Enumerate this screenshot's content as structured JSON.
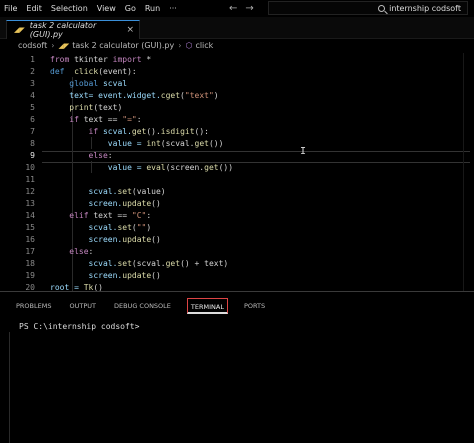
{
  "menu": [
    "File",
    "Edit",
    "Selection",
    "View",
    "Go",
    "Run",
    "···"
  ],
  "nav": {
    "back": "←",
    "forward": "→"
  },
  "search": {
    "text": "internship codsoft"
  },
  "tab": {
    "label": "task 2 calculator (GUI).py",
    "icon": "py-file-icon",
    "close": "×"
  },
  "breadcrumb": {
    "folder": "codsoft",
    "file": "task 2 calculator (GUI).py",
    "symbol": "click"
  },
  "editor": {
    "active_line": 9,
    "lines": [
      {
        "n": "1",
        "tokens": [
          {
            "t": "from",
            "c": "kw"
          },
          {
            "t": " tkinter ",
            "c": "plain"
          },
          {
            "t": "import",
            "c": "kw"
          },
          {
            "t": " *",
            "c": "plain"
          }
        ]
      },
      {
        "n": "2",
        "tokens": [
          {
            "t": "def",
            "c": "kw2"
          },
          {
            "t": "  ",
            "c": "plain"
          },
          {
            "t": "click",
            "c": "fn"
          },
          {
            "t": "(event):",
            "c": "plain"
          }
        ]
      },
      {
        "n": "3",
        "tokens": [
          {
            "t": "    ",
            "c": "plain"
          },
          {
            "t": "global",
            "c": "kw2"
          },
          {
            "t": " scval",
            "c": "var"
          }
        ]
      },
      {
        "n": "4",
        "tokens": [
          {
            "t": "    text= event.widget.",
            "c": "var"
          },
          {
            "t": "cget",
            "c": "fn"
          },
          {
            "t": "(",
            "c": "plain"
          },
          {
            "t": "\"text\"",
            "c": "str"
          },
          {
            "t": ")",
            "c": "plain"
          }
        ]
      },
      {
        "n": "5",
        "tokens": [
          {
            "t": "    ",
            "c": "plain"
          },
          {
            "t": "print",
            "c": "fn"
          },
          {
            "t": "(text)",
            "c": "plain"
          }
        ]
      },
      {
        "n": "6",
        "tokens": [
          {
            "t": "    ",
            "c": "plain"
          },
          {
            "t": "if",
            "c": "kw"
          },
          {
            "t": " text == ",
            "c": "plain"
          },
          {
            "t": "\"=\"",
            "c": "str"
          },
          {
            "t": ":",
            "c": "plain"
          }
        ]
      },
      {
        "n": "7",
        "tokens": [
          {
            "t": "        ",
            "c": "plain"
          },
          {
            "t": "if",
            "c": "kw"
          },
          {
            "t": " scval.",
            "c": "var"
          },
          {
            "t": "get",
            "c": "fn"
          },
          {
            "t": "().",
            "c": "plain"
          },
          {
            "t": "isdigit",
            "c": "fn"
          },
          {
            "t": "():",
            "c": "plain"
          }
        ]
      },
      {
        "n": "8",
        "tokens": [
          {
            "t": "            value = ",
            "c": "var"
          },
          {
            "t": "int",
            "c": "fn"
          },
          {
            "t": "(scval.",
            "c": "plain"
          },
          {
            "t": "get",
            "c": "fn"
          },
          {
            "t": "())",
            "c": "plain"
          }
        ]
      },
      {
        "n": "9",
        "tokens": [
          {
            "t": "        ",
            "c": "plain"
          },
          {
            "t": "else",
            "c": "kw"
          },
          {
            "t": ":",
            "c": "plain"
          }
        ]
      },
      {
        "n": "10",
        "tokens": [
          {
            "t": "            value = ",
            "c": "var"
          },
          {
            "t": "eval",
            "c": "fn"
          },
          {
            "t": "(screen.",
            "c": "plain"
          },
          {
            "t": "get",
            "c": "fn"
          },
          {
            "t": "())",
            "c": "plain"
          }
        ]
      },
      {
        "n": "11",
        "tokens": []
      },
      {
        "n": "12",
        "tokens": [
          {
            "t": "        scval.",
            "c": "var"
          },
          {
            "t": "set",
            "c": "fn"
          },
          {
            "t": "(value)",
            "c": "plain"
          }
        ]
      },
      {
        "n": "13",
        "tokens": [
          {
            "t": "        screen.",
            "c": "var"
          },
          {
            "t": "update",
            "c": "fn"
          },
          {
            "t": "()",
            "c": "plain"
          }
        ]
      },
      {
        "n": "14",
        "tokens": [
          {
            "t": "    ",
            "c": "plain"
          },
          {
            "t": "elif",
            "c": "kw"
          },
          {
            "t": " text == ",
            "c": "plain"
          },
          {
            "t": "\"C\"",
            "c": "str"
          },
          {
            "t": ":",
            "c": "plain"
          }
        ]
      },
      {
        "n": "15",
        "tokens": [
          {
            "t": "        scval.",
            "c": "var"
          },
          {
            "t": "set",
            "c": "fn"
          },
          {
            "t": "(",
            "c": "plain"
          },
          {
            "t": "\"\"",
            "c": "str"
          },
          {
            "t": ")",
            "c": "plain"
          }
        ]
      },
      {
        "n": "16",
        "tokens": [
          {
            "t": "        screen.",
            "c": "var"
          },
          {
            "t": "update",
            "c": "fn"
          },
          {
            "t": "()",
            "c": "plain"
          }
        ]
      },
      {
        "n": "17",
        "tokens": [
          {
            "t": "    ",
            "c": "plain"
          },
          {
            "t": "else",
            "c": "kw"
          },
          {
            "t": ":",
            "c": "plain"
          }
        ]
      },
      {
        "n": "18",
        "tokens": [
          {
            "t": "        scval.",
            "c": "var"
          },
          {
            "t": "set",
            "c": "fn"
          },
          {
            "t": "(scval.",
            "c": "plain"
          },
          {
            "t": "get",
            "c": "fn"
          },
          {
            "t": "() + text)",
            "c": "plain"
          }
        ]
      },
      {
        "n": "19",
        "tokens": [
          {
            "t": "        screen.",
            "c": "var"
          },
          {
            "t": "update",
            "c": "fn"
          },
          {
            "t": "()",
            "c": "plain"
          }
        ]
      },
      {
        "n": "20",
        "tokens": [
          {
            "t": "root = ",
            "c": "var"
          },
          {
            "t": "Tk",
            "c": "fn"
          },
          {
            "t": "()",
            "c": "plain"
          }
        ]
      }
    ]
  },
  "panel": {
    "tabs": [
      "PROBLEMS",
      "OUTPUT",
      "DEBUG CONSOLE",
      "TERMINAL",
      "PORTS"
    ],
    "active_tab": "TERMINAL",
    "prompt": "PS C:\\internship codsoft>"
  },
  "colors": {
    "accent": "#3a8fd9",
    "active_tab_border": "#dd4444"
  }
}
